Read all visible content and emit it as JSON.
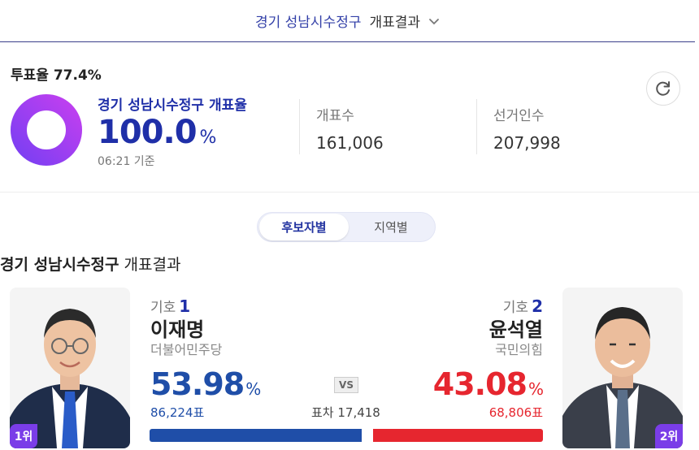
{
  "header": {
    "region": "경기 성남시수정구",
    "suffix": "개표결과"
  },
  "turnout": {
    "label": "투표율",
    "value": "77.4%"
  },
  "count_rate": {
    "label": "경기 성남시수정구 개표율",
    "value": "100.0",
    "unit": "%",
    "time": "06:21 기준",
    "fraction": 1.0
  },
  "stats": {
    "counted_label": "개표수",
    "counted_value": "161,006",
    "electors_label": "선거인수",
    "electors_value": "207,998"
  },
  "tabs": [
    {
      "label": "후보자별",
      "active": true
    },
    {
      "label": "지역별",
      "active": false
    }
  ],
  "section": {
    "region": "경기 성남시수정구",
    "suffix": "개표결과"
  },
  "candidates": [
    {
      "num_label": "기호",
      "num": "1",
      "name": "이재명",
      "party": "더불어민주당",
      "pct": "53.98",
      "pct_unit": "%",
      "votes": "86,224표",
      "rank": "1위",
      "color": "#1f4ea8",
      "share": 53.98
    },
    {
      "num_label": "기호",
      "num": "2",
      "name": "윤석열",
      "party": "국민의힘",
      "pct": "43.08",
      "pct_unit": "%",
      "votes": "68,806표",
      "rank": "2위",
      "color": "#e6262f",
      "share": 43.08
    }
  ],
  "vs": "VS",
  "gap": "표차 17,418",
  "colors": {
    "accent": "#1f2fa8",
    "rank_badge": "#7a3de8",
    "donut_start": "#7b3ff2",
    "donut_end": "#c13ff0"
  },
  "icons": {
    "refresh": "refresh-icon",
    "dropdown": "chevron-down-icon"
  }
}
